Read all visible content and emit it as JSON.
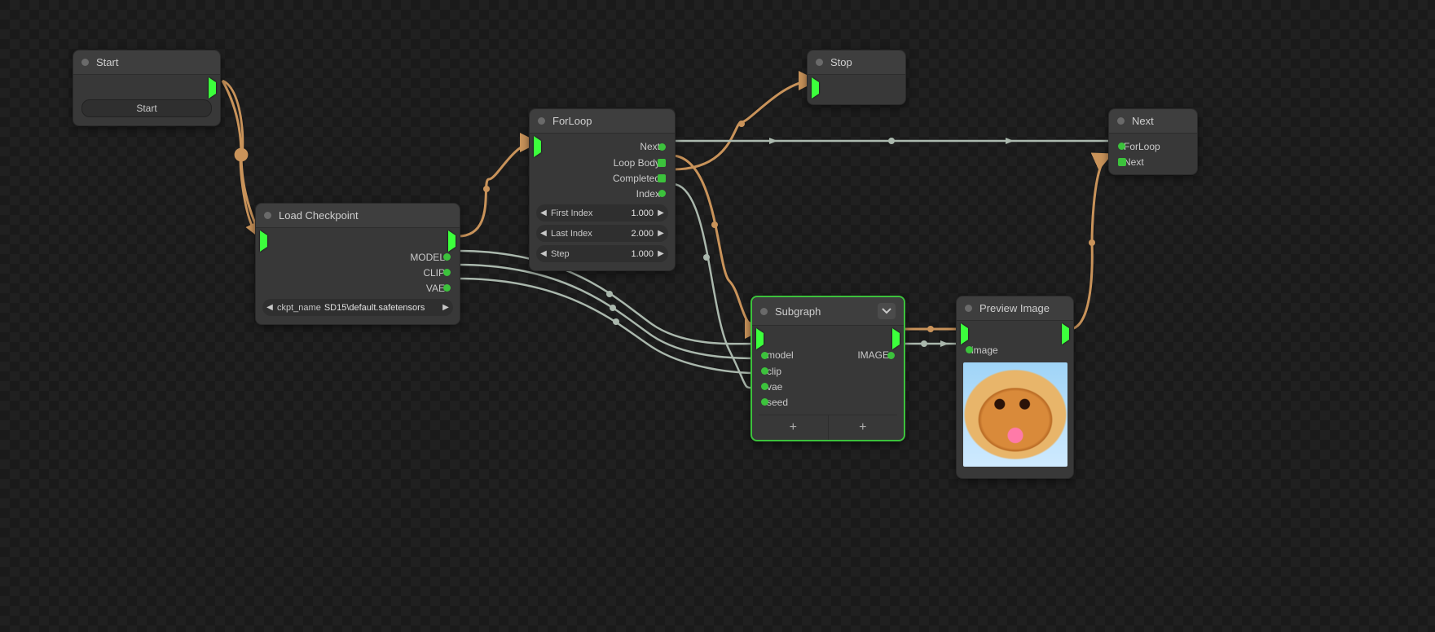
{
  "nodes": {
    "start": {
      "title": "Start",
      "button_label": "Start"
    },
    "load_checkpoint": {
      "title": "Load Checkpoint",
      "outputs": {
        "model": "MODEL",
        "clip": "CLIP",
        "vae": "VAE"
      },
      "widget_ckpt": {
        "label": "ckpt_name",
        "value": "SD15\\default.safetensors"
      }
    },
    "forloop": {
      "title": "ForLoop",
      "outputs": {
        "next": "Next",
        "loop_body": "Loop Body",
        "completed": "Completed",
        "index": "Index"
      },
      "widgets": {
        "first_index": {
          "label": "First Index",
          "value": "1.000"
        },
        "last_index": {
          "label": "Last Index",
          "value": "2.000"
        },
        "step": {
          "label": "Step",
          "value": "1.000"
        }
      }
    },
    "stop": {
      "title": "Stop"
    },
    "subgraph": {
      "title": "Subgraph",
      "inputs": {
        "model": "model",
        "clip": "clip",
        "vae": "vae",
        "seed": "seed"
      },
      "outputs": {
        "image": "IMAGE"
      }
    },
    "preview": {
      "title": "Preview Image",
      "inputs": {
        "image": "image"
      }
    },
    "next": {
      "title": "Next",
      "inputs": {
        "forloop": "ForLoop",
        "next": "Next"
      }
    }
  },
  "edges": [
    {
      "from": "start.exec_out",
      "to": "load_checkpoint.exec_in",
      "kind": "exec"
    },
    {
      "from": "load_checkpoint.exec_out",
      "to": "forloop.exec_in",
      "kind": "exec"
    },
    {
      "from": "forloop.completed",
      "to": "stop.exec_in",
      "kind": "exec"
    },
    {
      "from": "forloop.loop_body",
      "to": "subgraph.exec_in",
      "kind": "exec"
    },
    {
      "from": "forloop.next",
      "to": "next.forloop",
      "kind": "data"
    },
    {
      "from": "forloop.index",
      "to": "subgraph.seed",
      "kind": "data"
    },
    {
      "from": "load_checkpoint.model",
      "to": "subgraph.model",
      "kind": "data"
    },
    {
      "from": "load_checkpoint.clip",
      "to": "subgraph.clip",
      "kind": "data"
    },
    {
      "from": "load_checkpoint.vae",
      "to": "subgraph.vae",
      "kind": "data"
    },
    {
      "from": "subgraph.exec_out",
      "to": "preview.exec_in",
      "kind": "exec"
    },
    {
      "from": "subgraph.image",
      "to": "preview.image",
      "kind": "data"
    },
    {
      "from": "preview.exec_out",
      "to": "next.next",
      "kind": "exec"
    }
  ],
  "colors": {
    "exec_wire": "#c9935a",
    "data_wire": "#aab8ad",
    "exec_pin": "#3cff3c",
    "data_pin": "#3cc23c"
  }
}
